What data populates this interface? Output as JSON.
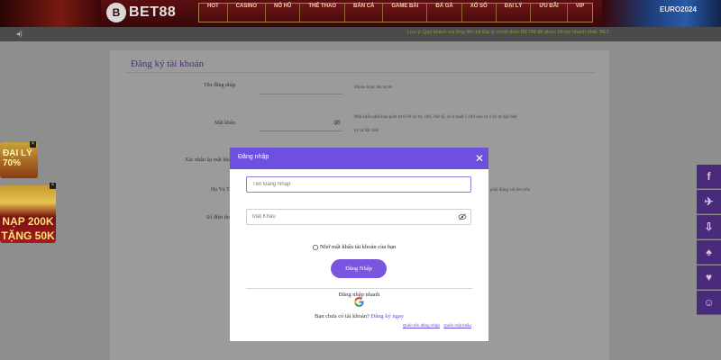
{
  "header": {
    "logo_mark": "B",
    "logo_text": "BET88",
    "nav": [
      "HOT",
      "CASINO",
      "NỔ HŨ",
      "THỂ THAO",
      "BẮN CÁ",
      "GAME BÀI",
      "ĐÁ GÀ",
      "XỔ SỐ",
      "ĐẠI LÝ",
      "ƯU ĐÃI",
      "VIP"
    ],
    "badge": "EURO2024"
  },
  "marquee": {
    "icon": "speaker-icon",
    "text": "Lưu ý: Quý khách vui lòng liên hệ Đại lý chính thức BET88 để được hỗ trợ nhanh nhất. BET"
  },
  "register": {
    "title": "Đăng ký tài khoản",
    "username_label": "Tên đăng nhập",
    "username_hint": "Phone hoặc tên tự do",
    "password_label": "Mật khẩu",
    "password_hint_1": "Mật khẩu phải bao gồm từ 6-10 ký tự, chữ, chữ số, có ít nhất 1 chữ hoa và 1 ký tự đặc biệt",
    "password_hint_2": "ký tự đặc biệt",
    "confirm_label": "Xác nhận lại mật khẩu",
    "field4_label": "Họ Và Tên",
    "field4_hint": "phải đúng với tên trên",
    "field5_label": "Số điện thoại"
  },
  "promo": {
    "p1": "ĐẠI LÝ 70%",
    "p2_line1": "NẠP 200K",
    "p2_line2": "TẶNG 50K",
    "close": "×"
  },
  "side_bar": [
    "f",
    "✈",
    "⇩",
    "♠",
    "♥",
    "☺"
  ],
  "modal": {
    "title": "Đăng nhập",
    "close": "✕",
    "username_placeholder": "Tên Đăng Nhập",
    "password_placeholder": "Mật Khẩu",
    "remember": "Nhớ mật khẩu tài khoản của bạn",
    "login_button": "Đăng Nhập",
    "quick_login": "Đăng nhập nhanh",
    "no_account": "Bạn chưa có tài khoản?",
    "register_link": "Đăng ký ngay",
    "forgot_username": "Quên tên đăng nhập",
    "forgot_password": "Quên mật khẩu"
  },
  "colors": {
    "accent": "#6f4fe0",
    "button": "#7a55e0",
    "header_bg": "#5a0f10",
    "overlay": "#8e8e8e"
  }
}
